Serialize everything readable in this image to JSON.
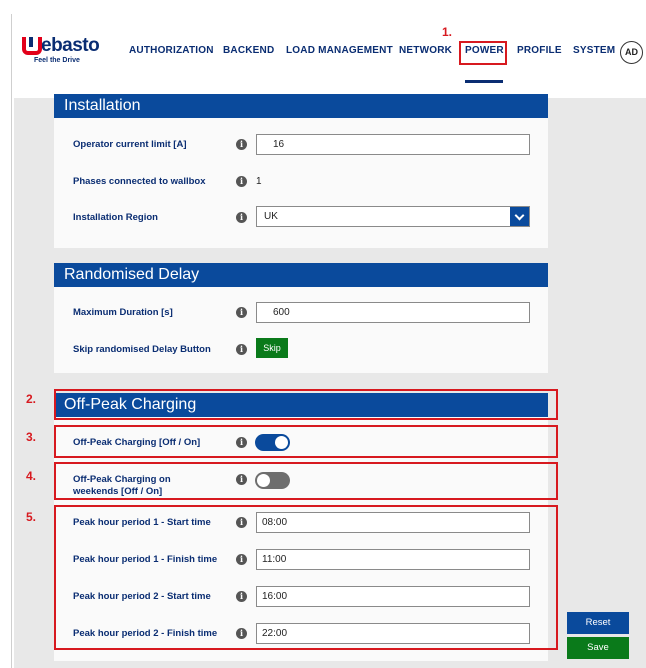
{
  "brand": {
    "name": "Webasto",
    "name_rest": "ebasto",
    "tagline": "Feel the Drive"
  },
  "nav": {
    "items": [
      "AUTHORIZATION",
      "BACKEND",
      "LOAD MANAGEMENT",
      "NETWORK",
      "POWER",
      "PROFILE",
      "SYSTEM"
    ],
    "active": "POWER",
    "avatar": "AD"
  },
  "annotations": [
    "1.",
    "2.",
    "3.",
    "4.",
    "5."
  ],
  "annotation_color": "#d7191f",
  "accent_color": "#0a4a9c",
  "installation": {
    "title": "Installation",
    "operator_current_limit": {
      "label": "Operator current limit [A]",
      "value": "16"
    },
    "phases_connected": {
      "label": "Phases connected to wallbox",
      "value": "1"
    },
    "installation_region": {
      "label": "Installation Region",
      "value": "UK"
    }
  },
  "randomised_delay": {
    "title": "Randomised Delay",
    "maximum_duration": {
      "label": "Maximum Duration [s]",
      "value": "600"
    },
    "skip": {
      "label": "Skip randomised Delay Button",
      "button": "Skip"
    }
  },
  "off_peak": {
    "title": "Off-Peak Charging",
    "toggle": {
      "label": "Off-Peak Charging [Off / On]",
      "state": "on"
    },
    "weekends": {
      "label_line1": "Off-Peak Charging on",
      "label_line2": "weekends [Off / On]",
      "state": "off"
    },
    "periods": [
      {
        "label": "Peak hour period 1 - Start time",
        "value": "08:00"
      },
      {
        "label": "Peak hour period 1 - Finish time",
        "value": "11:00"
      },
      {
        "label": "Peak hour period 2 - Start time",
        "value": "16:00"
      },
      {
        "label": "Peak hour period 2 - Finish time",
        "value": "22:00"
      }
    ]
  },
  "actions": {
    "reset": "Reset",
    "save": "Save"
  },
  "info_glyph": "i"
}
